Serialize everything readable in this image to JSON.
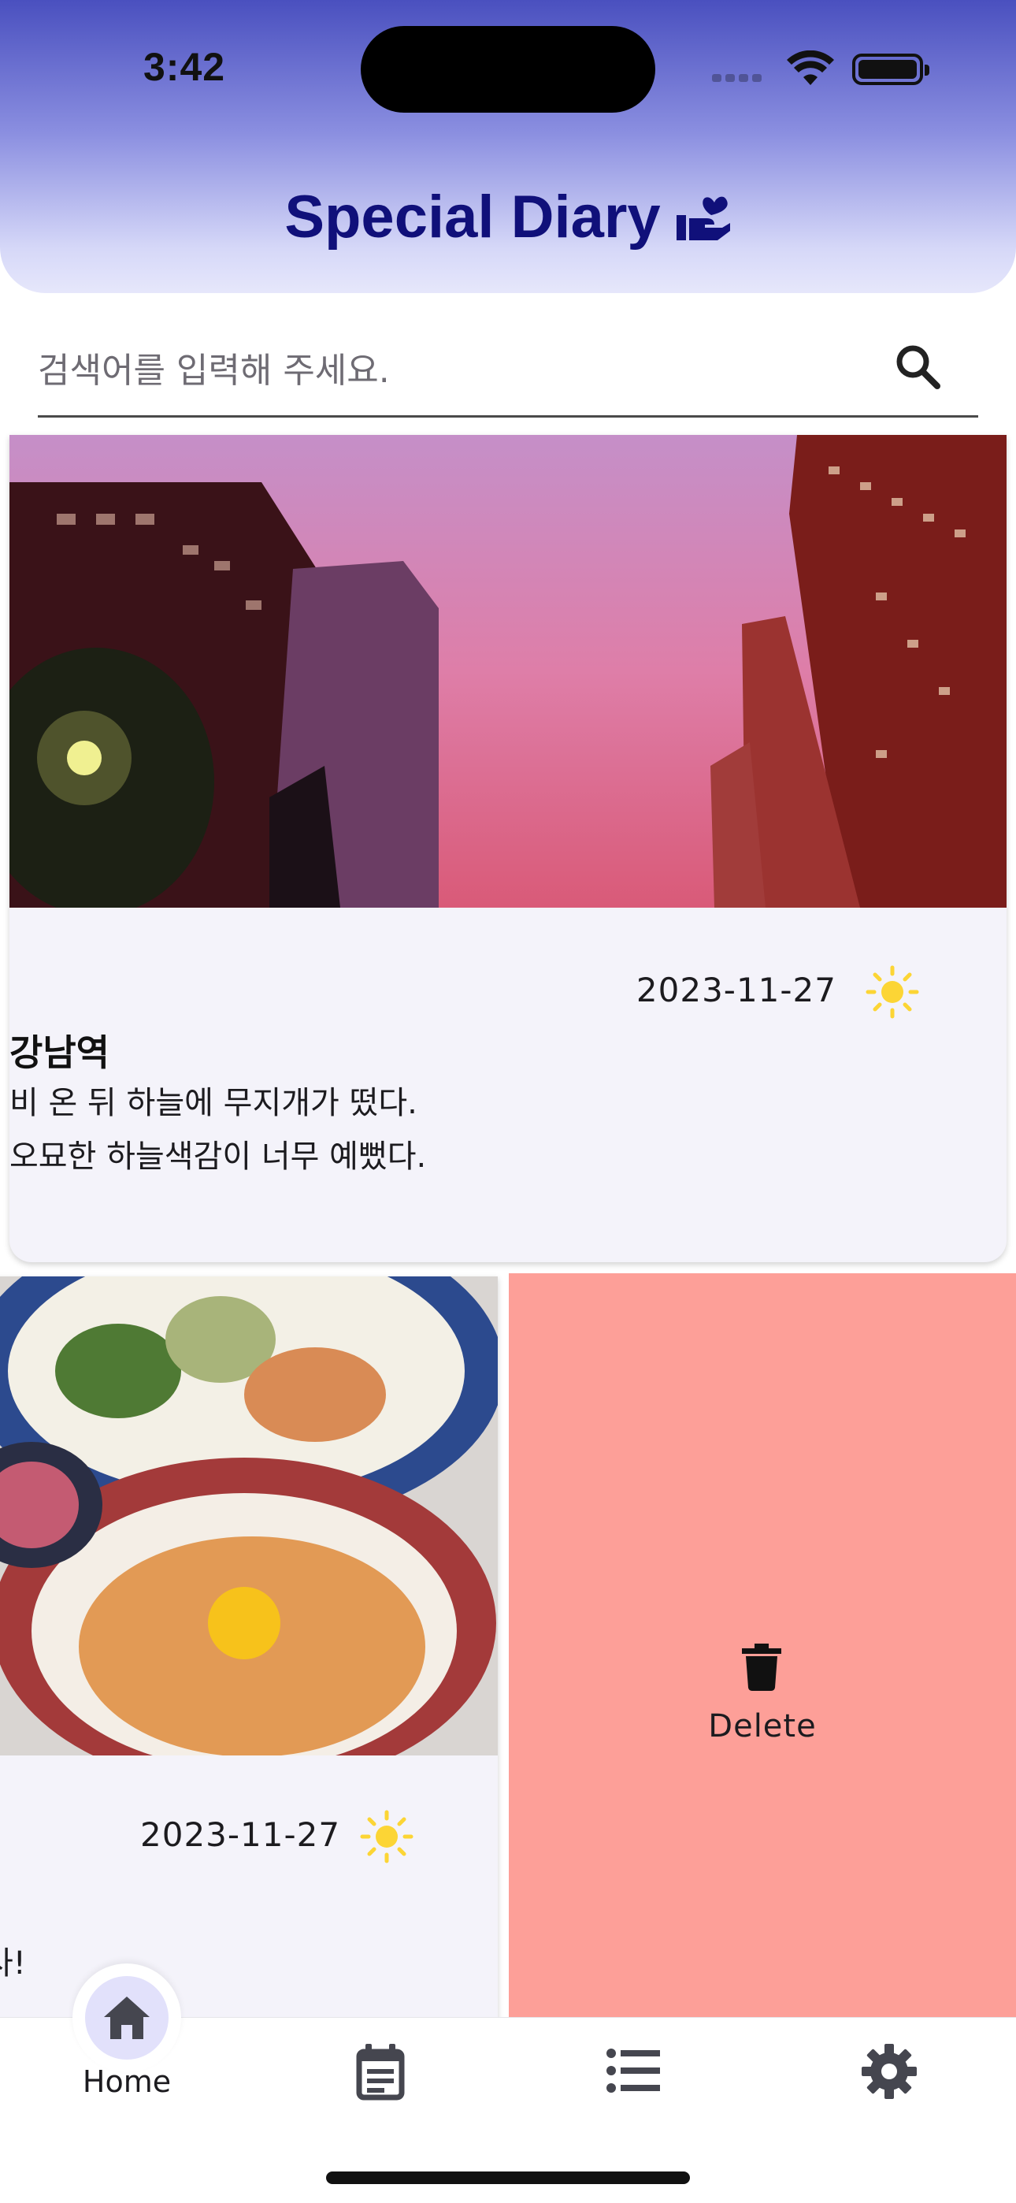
{
  "status_bar": {
    "time": "3:42"
  },
  "header": {
    "title": "Special Diary",
    "logo_icon": "hand-heart-icon"
  },
  "search": {
    "placeholder": "검색어를 입력해 주세요.",
    "icon": "search-icon"
  },
  "entries": [
    {
      "image": "city-sunset-photo",
      "date": "2023-11-27",
      "weather_icon": "sun-icon",
      "title": "강남역",
      "body_line1": "비 온 뒤 하늘에 무지개가 떴다.",
      "body_line2": "오묘한 하늘색감이 너무 예뻤다."
    },
    {
      "image": "food-plates-photo",
      "date": "2023-11-27",
      "weather_icon": "sun-icon",
      "body_fragment": "사!"
    }
  ],
  "swipe_action": {
    "label": "Delete",
    "icon": "trash-icon",
    "color": "#fd9f98"
  },
  "nav": {
    "items": [
      {
        "label": "Home",
        "icon": "home-icon",
        "active": true
      },
      {
        "label": "",
        "icon": "calendar-note-icon"
      },
      {
        "label": "",
        "icon": "list-icon"
      },
      {
        "label": "",
        "icon": "gear-icon"
      }
    ]
  },
  "colors": {
    "accent": "#10107a",
    "active_indicator": "#e2e1fb",
    "sun": "#fcd535"
  }
}
